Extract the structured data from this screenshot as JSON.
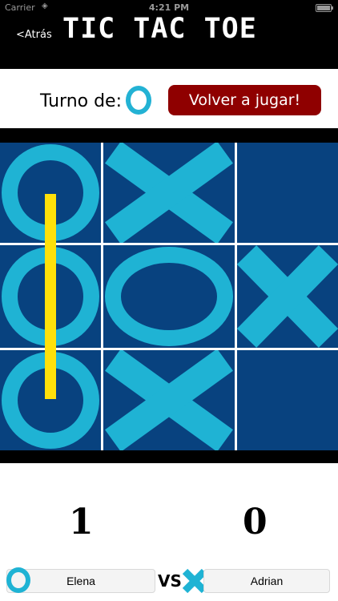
{
  "status_bar": {
    "carrier": "Carrier",
    "time": "4:21 PM",
    "battery_level": 1.0
  },
  "nav": {
    "back_label": "<Atrás",
    "title": "TIC TAC TOE"
  },
  "turn": {
    "label": "Turno de:",
    "current_symbol": "O"
  },
  "replay_button": {
    "label": "Volver a jugar!"
  },
  "board": {
    "cells": [
      "O",
      "X",
      "",
      "O",
      "O",
      "X",
      "O",
      "X",
      ""
    ],
    "winning_line": "left-column"
  },
  "scores": {
    "player1": "1",
    "player2": "0"
  },
  "players": {
    "player1": {
      "name": "Elena",
      "symbol": "O"
    },
    "player2": {
      "name": "Adrian",
      "symbol": "X"
    },
    "vs_label": "VS"
  },
  "colors": {
    "board_blue": "#08427f",
    "piece_cyan": "#1fb3d4",
    "win_yellow": "#ffe10a",
    "button_red": "#8f0000"
  },
  "icons": {
    "wifi": "wifi-icon",
    "battery": "battery-icon",
    "o_piece": "o-icon",
    "x_piece": "x-icon"
  }
}
